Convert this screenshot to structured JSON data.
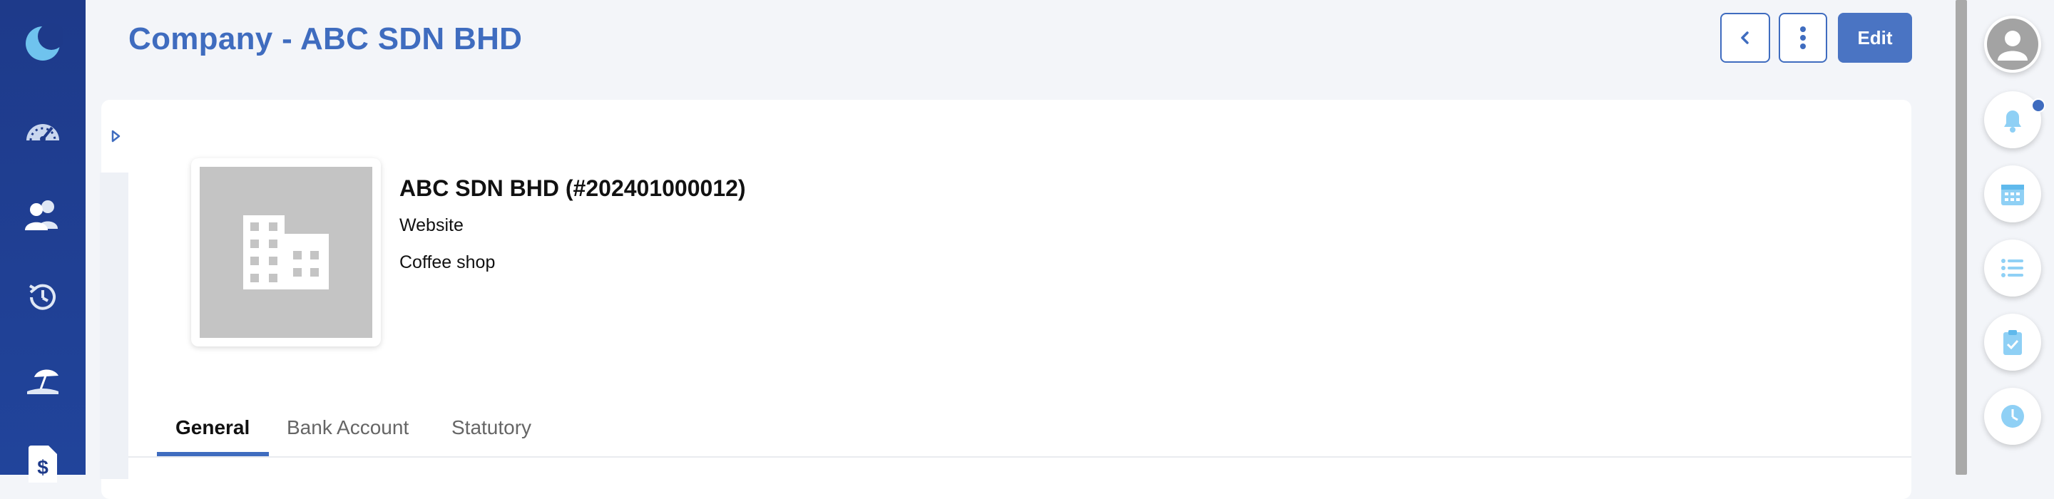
{
  "header": {
    "title": "Company - ABC SDN BHD",
    "edit_label": "Edit"
  },
  "company": {
    "name_with_id": "ABC SDN BHD (#202401000012)",
    "website": "Website",
    "description": "Coffee shop"
  },
  "tabs": [
    {
      "label": "General",
      "active": true
    },
    {
      "label": "Bank Account",
      "active": false
    },
    {
      "label": "Statutory",
      "active": false
    }
  ],
  "left_nav": {
    "items": [
      "moon-logo-icon",
      "dashboard-gauge-icon",
      "people-icon",
      "history-clock-icon",
      "leave-beach-icon",
      "payroll-document-icon"
    ]
  },
  "right_rail": {
    "items": [
      "avatar-icon",
      "bell-icon",
      "calendar-icon",
      "list-icon",
      "clipboard-check-icon",
      "clock-icon"
    ],
    "has_notification": true
  },
  "colors": {
    "primary": "#3f6cbf",
    "nav_bg": "#1e3a8a",
    "rail_icon": "#8fd0f5"
  }
}
